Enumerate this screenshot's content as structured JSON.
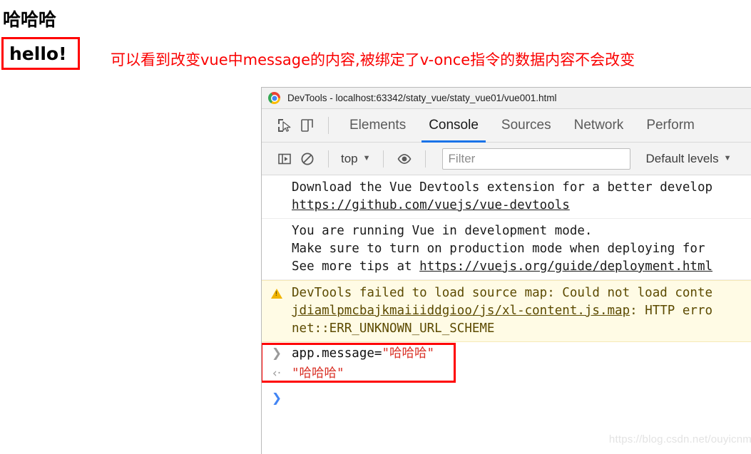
{
  "page": {
    "heading_text": "哈哈哈",
    "hello_box_text": "hello!",
    "annotation_text": "可以看到改变vue中message的内容,被绑定了v-once指令的数据内容不会改变",
    "annotation_color": "#fa0000",
    "highlight_border_color": "#ff0000"
  },
  "devtools": {
    "window_title": "DevTools - localhost:63342/staty_vue/staty_vue01/vue001.html",
    "tabs": [
      {
        "label": "Elements",
        "active": false
      },
      {
        "label": "Console",
        "active": true
      },
      {
        "label": "Sources",
        "active": false
      },
      {
        "label": "Network",
        "active": false
      },
      {
        "label": "Perform",
        "active": false
      }
    ],
    "toolbar": {
      "inspect_icon": "inspect-element-icon",
      "device_icon": "device-toolbar-icon",
      "sidebar_icon": "console-sidebar-icon",
      "clear_icon": "clear-console-icon",
      "context_label": "top",
      "context_caret": "▼",
      "eye_icon": "live-expression-eye-icon",
      "filter_placeholder": "Filter",
      "filter_value": "",
      "levels_label": "Default levels",
      "levels_caret": "▼"
    },
    "console": {
      "messages": [
        {
          "type": "log",
          "line1": "Download the Vue Devtools extension for a better develop",
          "link": "https://github.com/vuejs/vue-devtools"
        },
        {
          "type": "log",
          "line1": "You are running Vue in development mode.",
          "line2": "Make sure to turn on production mode when deploying for",
          "line3_prefix": "See more tips at ",
          "line3_link": "https://vuejs.org/guide/deployment.html"
        },
        {
          "type": "warning",
          "icon": "warning-triangle-icon",
          "line1": "DevTools failed to load source map: Could not load conte",
          "line2_link": "jdiamlpmcbajkmaiiiddgioo/js/xl-content.js.map",
          "line2_suffix": ": HTTP erro",
          "line3": "net::ERR_UNKNOWN_URL_SCHEME"
        }
      ],
      "evaluation": {
        "input_chevron": "❯",
        "input_expression": "app.message=",
        "input_value": "\"哈哈哈\"",
        "output_chevron": "‹·",
        "output_value": "\"哈哈哈\""
      },
      "prompt_chevron": "❯"
    },
    "watermark": "https://blog.csdn.net/ouyicnm"
  }
}
